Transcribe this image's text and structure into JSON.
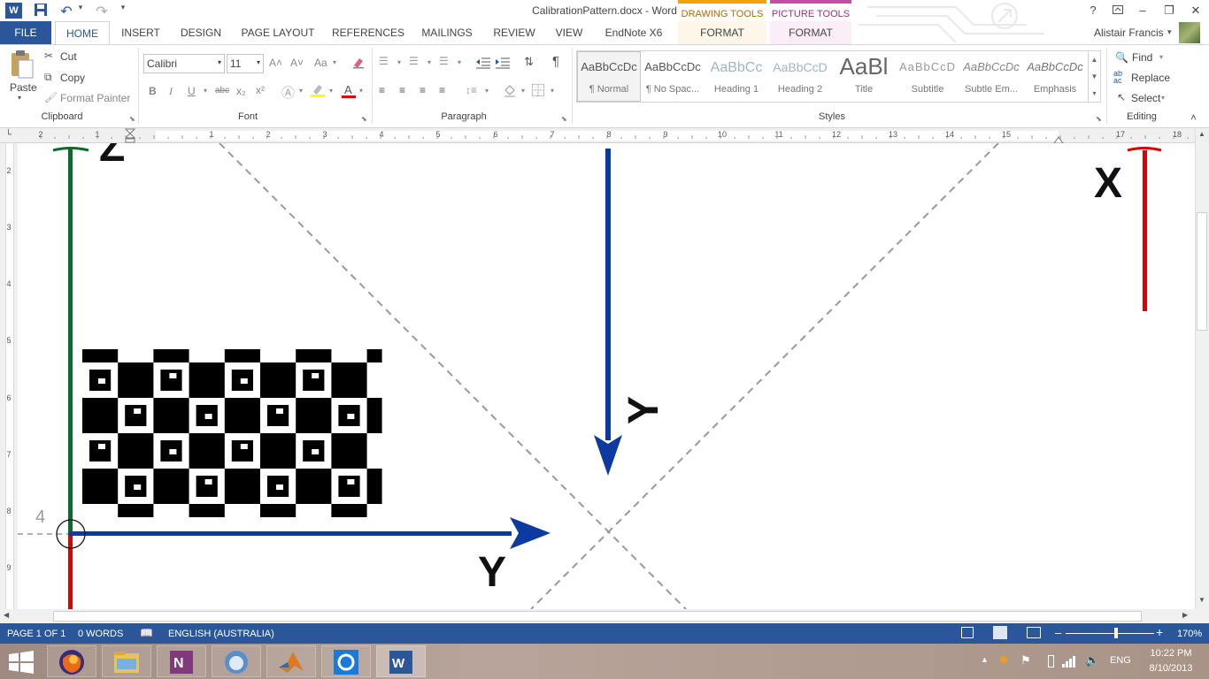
{
  "window": {
    "title": "CalibrationPattern.docx - Word",
    "help": "?",
    "min": "–",
    "restore": "❐",
    "close": "✕"
  },
  "qat": {
    "word_icon": "W",
    "save_icon": "save-icon",
    "undo": "↶",
    "redo": "↷",
    "more": "▾"
  },
  "tabs": [
    "FILE",
    "HOME",
    "INSERT",
    "DESIGN",
    "PAGE LAYOUT",
    "REFERENCES",
    "MAILINGS",
    "REVIEW",
    "VIEW",
    "EndNote X6"
  ],
  "context_tabs": {
    "drawing": {
      "group": "DRAWING TOOLS",
      "tab": "FORMAT",
      "color": "#f0a30a"
    },
    "picture": {
      "group": "PICTURE TOOLS",
      "tab": "FORMAT",
      "color": "#c04fa6"
    }
  },
  "user": {
    "name": "Alistair Francis"
  },
  "clipboard": {
    "paste": "Paste",
    "cut": "Cut",
    "copy": "Copy",
    "format_painter": "Format Painter",
    "label": "Clipboard"
  },
  "font": {
    "name": "Calibri",
    "size": "11",
    "label": "Font",
    "bold": "B",
    "italic": "I",
    "underline": "U",
    "strike": "abc",
    "sub": "x₂",
    "sup": "x²",
    "grow": "A˄",
    "shrink": "A˅",
    "case": "Aa"
  },
  "paragraph": {
    "label": "Paragraph",
    "pilcrow": "¶"
  },
  "styles": {
    "label": "Styles",
    "items": [
      {
        "preview": "AaBbCcDc",
        "name": "¶ Normal"
      },
      {
        "preview": "AaBbCcDc",
        "name": "¶ No Spac..."
      },
      {
        "preview": "AaBbCc",
        "name": "Heading 1"
      },
      {
        "preview": "AaBbCcD",
        "name": "Heading 2"
      },
      {
        "preview": "AaBl",
        "name": "Title"
      },
      {
        "preview": "AaBbCcD",
        "name": "Subtitle"
      },
      {
        "preview": "AaBbCcDc",
        "name": "Subtle Em..."
      },
      {
        "preview": "AaBbCcDc",
        "name": "Emphasis"
      }
    ]
  },
  "editing": {
    "find": "Find",
    "replace": "Replace",
    "select": "Select",
    "label": "Editing"
  },
  "ruler": {
    "h": [
      "2",
      "1",
      "",
      "1",
      "2",
      "3",
      "4",
      "5",
      "6",
      "7",
      "8",
      "9",
      "10",
      "11",
      "12",
      "13",
      "14",
      "15",
      "16",
      "17",
      "18"
    ],
    "v": [
      "2",
      "3",
      "4",
      "5",
      "6",
      "7",
      "8",
      "9"
    ]
  },
  "document": {
    "label_z": "Z",
    "label_x": "X",
    "label_y": "Y",
    "label_y2": "Y",
    "corner_num": "4"
  },
  "status": {
    "page": "PAGE 1 OF 1",
    "words": "0 WORDS",
    "language": "ENGLISH (AUSTRALIA)",
    "zoom": "170%"
  },
  "taskbar": {
    "apps": [
      "firefox-icon",
      "explorer-icon",
      "onenote-icon",
      "cat-icon",
      "matlab-icon",
      "update-icon",
      "word-icon"
    ],
    "lang": "ENG",
    "time": "10:22 PM",
    "date": "8/10/2013"
  }
}
